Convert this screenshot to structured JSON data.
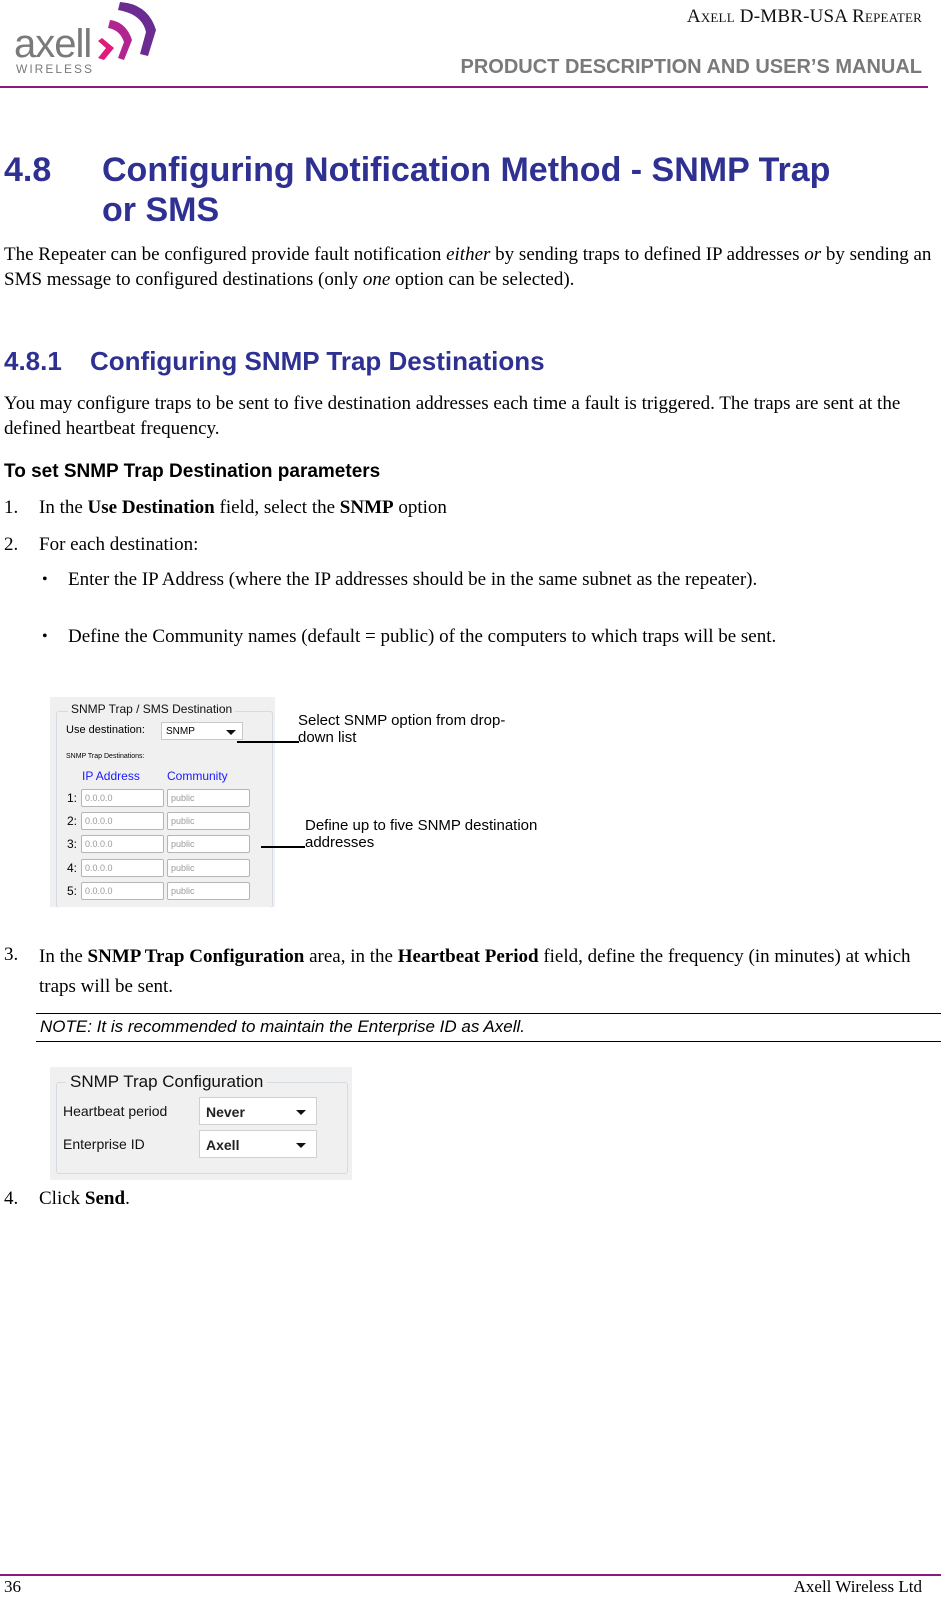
{
  "header": {
    "logo": {
      "name": "axell",
      "sub": "WIRELESS"
    },
    "title": "Axell D-MBR-USA Repeater",
    "subtitle": "PRODUCT DESCRIPTION AND USER’S MANUAL",
    "accent_color": "#8b1a7e"
  },
  "section": {
    "number": "4.8",
    "title_line1": "Configuring Notification Method - SNMP Trap",
    "title_line2": "or SMS",
    "heading_color": "#2e3192",
    "intro": {
      "p1": "The Repeater can be configured provide fault notification ",
      "em1": "either",
      "p2": " by sending traps to defined IP addresses ",
      "em2": "or",
      "p3": " by sending an SMS message to configured destinations (only ",
      "em3": "one",
      "p4": " option can be selected)."
    }
  },
  "subsection": {
    "number": "4.8.1",
    "title": "Configuring SNMP Trap Destinations",
    "intro": "You may configure traps to be sent to five destination addresses each time a fault is triggered. The traps are sent at the defined heartbeat frequency.",
    "procedure_title": "To set SNMP Trap Destination parameters"
  },
  "steps": [
    {
      "num": "1.",
      "t1": "In the ",
      "b1": "Use Destination",
      "t2": " field, select the ",
      "b2": "SNMP",
      "t3": " option"
    },
    {
      "num": "2.",
      "text": "For each destination:"
    },
    {
      "num": "3.",
      "t1": "In the ",
      "b1": "SNMP Trap Configuration",
      "t2": " area, in the ",
      "b2": "Heartbeat Period",
      "t3": " field, define the frequency (in minutes) at which traps will be sent."
    },
    {
      "num": "4.",
      "t1": "Click ",
      "b1": "Send",
      "t2": "."
    }
  ],
  "bullets": [
    "Enter the IP Address (where the IP addresses should be in the same subnet as the repeater).",
    "Define the Community names (default = public) of the computers to which traps will be sent."
  ],
  "snmp_dest_panel": {
    "legend": "SNMP Trap / SMS Destination",
    "use_destination_label": "Use destination:",
    "use_destination_value": "SNMP",
    "trap_destinations_label": "SNMP Trap Destinations:",
    "col_ip": "IP Address",
    "col_community": "Community",
    "rows": [
      {
        "num": "1:",
        "ip": "0.0.0.0",
        "community": "public"
      },
      {
        "num": "2:",
        "ip": "0.0.0.0",
        "community": "public"
      },
      {
        "num": "3:",
        "ip": "0.0.0.0",
        "community": "public"
      },
      {
        "num": "4:",
        "ip": "0.0.0.0",
        "community": "public"
      },
      {
        "num": "5:",
        "ip": "0.0.0.0",
        "community": "public"
      }
    ]
  },
  "callouts": {
    "select": "Select SNMP option from drop-down list",
    "define": "Define up to five SNMP destination addresses"
  },
  "note": "NOTE: It is recommended to maintain the Enterprise ID as Axell.",
  "snmp_config_panel": {
    "legend": "SNMP Trap Configuration",
    "heartbeat_label": "Heartbeat period",
    "heartbeat_value": "Never",
    "enterprise_label": "Enterprise ID",
    "enterprise_value": "Axell"
  },
  "footer": {
    "page_number": "36",
    "company": "Axell Wireless Ltd"
  }
}
